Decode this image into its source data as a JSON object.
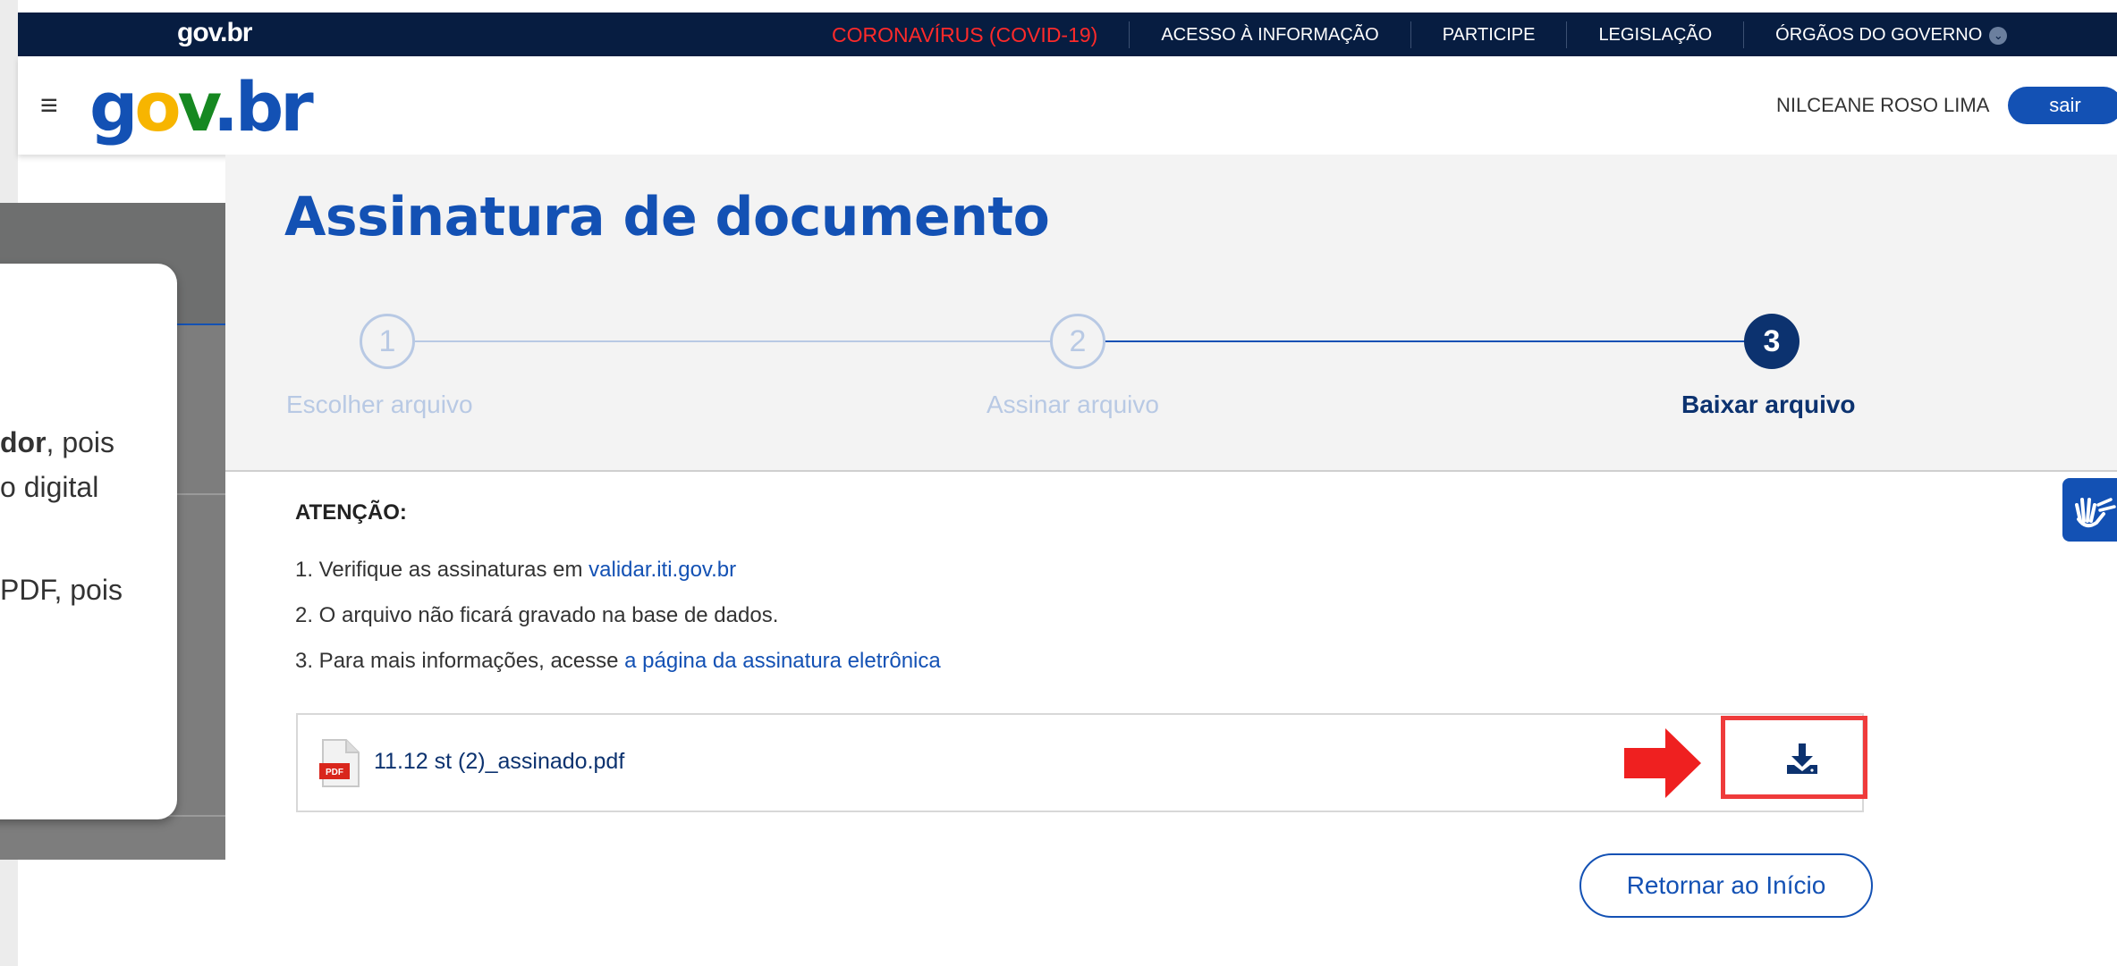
{
  "topbar": {
    "brand": "gov.br",
    "nav": [
      {
        "label": "CORONAVÍRUS (COVID-19)"
      },
      {
        "label": "ACESSO À INFORMAÇÃO"
      },
      {
        "label": "PARTICIPE"
      },
      {
        "label": "LEGISLAÇÃO"
      },
      {
        "label": "ÓRGÃOS DO GOVERNO"
      }
    ]
  },
  "header": {
    "logo": {
      "g": "g",
      "o": "o",
      "v": "v",
      "dot": ".",
      "br": "br"
    },
    "user_name": "NILCEANE ROSO LIMA",
    "logout_label": "sair"
  },
  "overlay": {
    "line1_bold": "dor",
    "line1_rest": ", pois",
    "line2": "o digital",
    "line3": "PDF, pois"
  },
  "page": {
    "title": "Assinatura de documento"
  },
  "stepper": {
    "steps": [
      {
        "number": "1",
        "label": "Escolher arquivo",
        "state": "inactive"
      },
      {
        "number": "2",
        "label": "Assinar arquivo",
        "state": "inactive"
      },
      {
        "number": "3",
        "label": "Baixar arquivo",
        "state": "active"
      }
    ]
  },
  "attention": {
    "title": "ATENÇÃO:",
    "item1_prefix": "1. Verifique as assinaturas em ",
    "item1_link": "validar.iti.gov.br",
    "item2": "2. O arquivo não ficará gravado na base de dados.",
    "item3_prefix": "3. Para mais informações, acesse ",
    "item3_link": "a página da assinatura eletrônica"
  },
  "file": {
    "icon_label": "PDF",
    "name": "11.12 st (2)_assinado.pdf"
  },
  "actions": {
    "return_label": "Retornar ao Início"
  },
  "colors": {
    "brand_blue": "#1351b4",
    "dark_navy": "#071d41",
    "highlight_red": "#ef3b3b",
    "covid_red": "#ff2a2a"
  }
}
